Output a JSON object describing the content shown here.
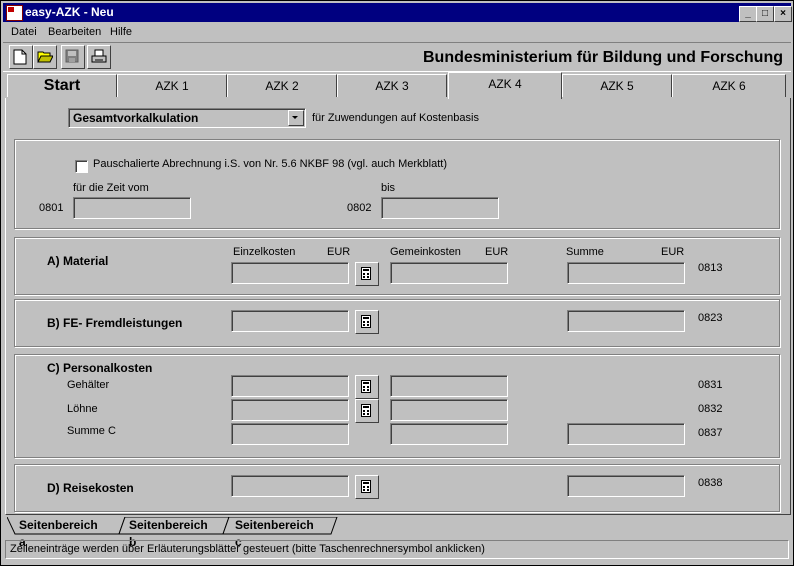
{
  "window": {
    "title": "easy-AZK - Neu",
    "min": "_",
    "max": "□",
    "close": "×"
  },
  "menu": [
    {
      "label": "Datei"
    },
    {
      "label": "Bearbeiten"
    },
    {
      "label": "Hilfe"
    }
  ],
  "toolbar": {
    "ministry": "Bundesministerium für Bildung und Forschung"
  },
  "tabs": [
    {
      "label": "Start"
    },
    {
      "label": "AZK 1"
    },
    {
      "label": "AZK 2"
    },
    {
      "label": "AZK 3"
    },
    {
      "label": "AZK 4"
    },
    {
      "label": "AZK 5"
    },
    {
      "label": "AZK 6"
    }
  ],
  "form": {
    "dropdown_value": "Gesamtvorkalkulation",
    "dropdown_suffix": "für Zuwendungen auf Kostenbasis",
    "checkbox_label": "Pauschalierte Abrechnung i.S. von Nr. 5.6 NKBF 98 (vgl. auch Merkblatt)",
    "from_label": "für die Zeit vom",
    "to_label": "bis",
    "code_from": "0801",
    "code_to": "0802",
    "material": {
      "label": "A) Material",
      "col_einzel": "Einzelkosten",
      "col_gemein": "Gemeinkosten",
      "col_summe": "Summe",
      "eur1": "EUR",
      "eur2": "EUR",
      "eur3": "EUR",
      "code": "0813"
    },
    "fe": {
      "label": "B) FE- Fremdleistungen",
      "code": "0823"
    },
    "personal": {
      "label": "C) Personalkosten",
      "rows": [
        {
          "label": "Gehälter",
          "code": "0831"
        },
        {
          "label": "Löhne",
          "code": "0832"
        },
        {
          "label": "Summe C",
          "code": "0837"
        }
      ]
    },
    "reise": {
      "label": "D) Reisekosten",
      "code": "0838"
    }
  },
  "bottom_tabs": [
    {
      "label": "Seitenbereich a"
    },
    {
      "label": "Seitenbereich b"
    },
    {
      "label": "Seitenbereich c"
    }
  ],
  "status": "Zeileneinträge werden über Erläuterungsblätter gesteuert (bitte Taschenrechnersymbol anklicken)"
}
